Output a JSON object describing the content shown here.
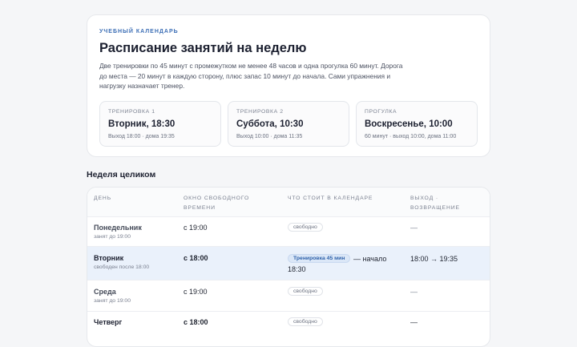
{
  "header": {
    "eyebrow": "УЧЕБНЫЙ КАЛЕНДАРЬ",
    "title": "Расписание занятий на неделю",
    "description": "Две тренировки по 45 минут с промежутком не менее 48 часов и одна прогулка 60 минут. Дорога до места — 20 минут в каждую сторону, плюс запас 10 минут до начала. Сами упражнения и нагрузку назначает тренер."
  },
  "sessions": [
    {
      "label": "ТРЕНИРОВКА 1",
      "time": "Вторник, 18:30",
      "note": "Выход 18:00 · дома 19:35"
    },
    {
      "label": "ТРЕНИРОВКА 2",
      "time": "Суббота, 10:30",
      "note": "Выход 10:00 · дома 11:35"
    },
    {
      "label": "ПРОГУЛКА",
      "time": "Воскресенье, 10:00",
      "note": "60 минут · выход 10:00, дома 11:00"
    }
  ],
  "week": {
    "title": "Неделя целиком",
    "columns": {
      "day": "ДЕНЬ",
      "window_line1": "ОКНО СВОБОДНОГО",
      "window_line2": "ВРЕМЕНИ",
      "calendar": "ЧТО СТОИТ В КАЛЕНДАРЕ",
      "return_line1": "ВЫХОД ·",
      "return_line2": "ВОЗВРАЩЕНИЕ"
    },
    "rows": [
      {
        "day": "Понедельник",
        "sub": "занят до 19:00",
        "window": "с 19:00",
        "calendar": "свободно",
        "return": "—"
      },
      {
        "day": "Вторник",
        "sub": "свободен после 18:00",
        "window": "с 18:00",
        "calendar": "Тренировка 45 мин",
        "calendar_after_1": "— начало",
        "calendar_after_2": "18:30",
        "return": "18:00 → 19:35"
      },
      {
        "day": "Среда",
        "sub": "занят до 19:00",
        "window": "с 19:00",
        "calendar": "свободно",
        "return": "—"
      },
      {
        "day": "Четверг",
        "sub": "",
        "window": "с 18:00",
        "calendar": "свободно",
        "return": "—"
      }
    ]
  }
}
